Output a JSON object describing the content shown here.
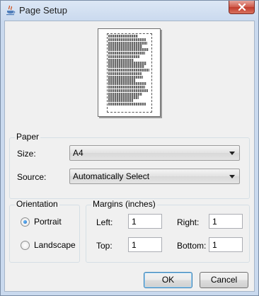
{
  "window": {
    "title": "Page Setup"
  },
  "preview": {
    "line_count": 21
  },
  "paper": {
    "legend": "Paper",
    "size_label": "Size:",
    "size_value": "A4",
    "source_label": "Source:",
    "source_value": "Automatically Select"
  },
  "orientation": {
    "legend": "Orientation",
    "portrait_label": "Portrait",
    "landscape_label": "Landscape",
    "selected": "Portrait"
  },
  "margins": {
    "legend": "Margins (inches)",
    "left_label": "Left:",
    "left_value": "1",
    "right_label": "Right:",
    "right_value": "1",
    "top_label": "Top:",
    "top_value": "1",
    "bottom_label": "Bottom:",
    "bottom_value": "1"
  },
  "buttons": {
    "ok": "OK",
    "cancel": "Cancel"
  },
  "icons": {
    "app": "java-cup-icon",
    "close": "close-icon"
  }
}
